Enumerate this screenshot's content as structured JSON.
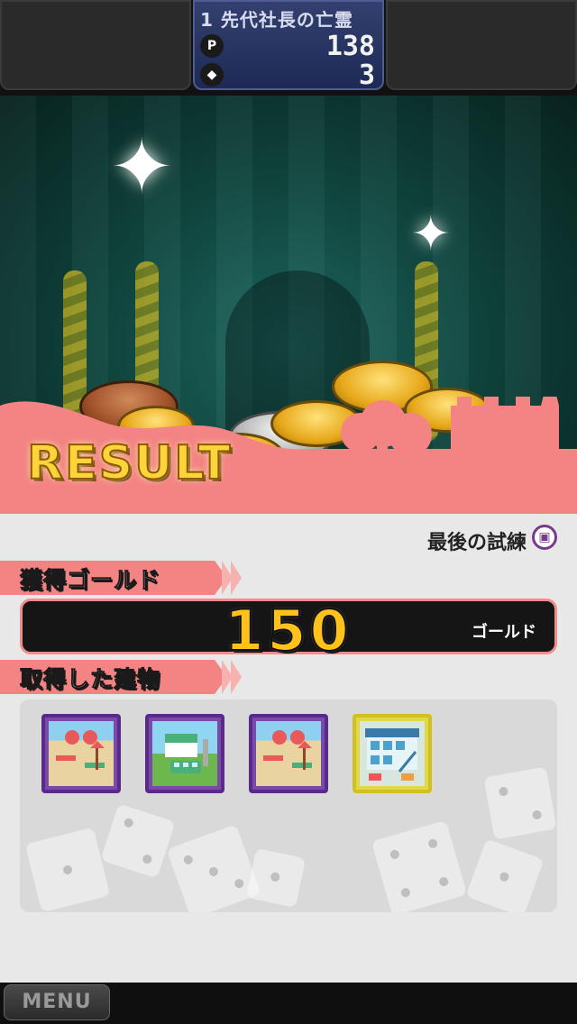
{
  "hud": {
    "stage_title": "1 先代社長の亡霊",
    "points_icon": "P",
    "points_value": "138",
    "items_value": "3"
  },
  "scene": {
    "result_text": "RESULT"
  },
  "panel": {
    "stage_label": "最後の試練",
    "gold_heading": "獲得ゴールド",
    "gold_value": "150",
    "gold_unit": "ゴールド",
    "buildings_heading": "取得した建物",
    "buildings": [
      {
        "icon": "beach-building-icon",
        "frame": "purple"
      },
      {
        "icon": "bus-station-building-icon",
        "frame": "purple"
      },
      {
        "icon": "beach-building-icon",
        "frame": "purple"
      },
      {
        "icon": "apartment-building-icon",
        "frame": "yellow"
      }
    ]
  },
  "bottom": {
    "menu_label": "MENU"
  },
  "colors": {
    "accent_pink": "#f38483",
    "gold": "#ffc21a",
    "hud_blue": "#33406f"
  }
}
